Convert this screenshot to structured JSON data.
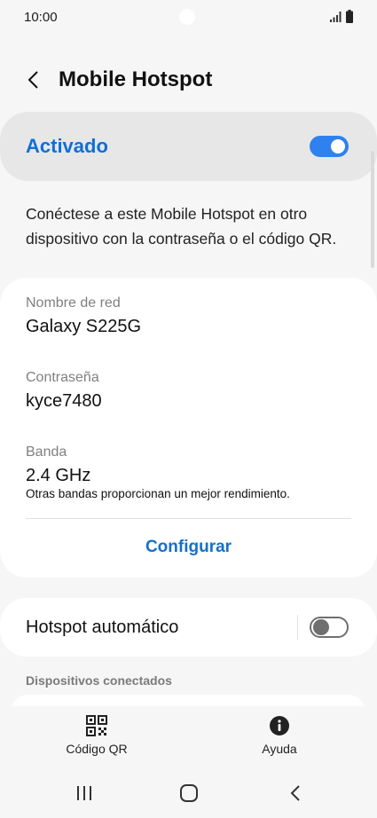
{
  "status_bar": {
    "time": "10:00"
  },
  "header": {
    "title": "Mobile Hotspot"
  },
  "master": {
    "label": "Activado",
    "enabled": true,
    "accent_color": "#0f6fd6"
  },
  "description": "Conéctese a este Mobile Hotspot en otro dispositivo con la contraseña o el código QR.",
  "network": {
    "name_label": "Nombre de red",
    "name_value": "Galaxy S225G",
    "password_label": "Contraseña",
    "password_value": "kyce7480",
    "band_label": "Banda",
    "band_value": "2.4 GHz",
    "band_note": "Otras bandas proporcionan un mejor rendimiento.",
    "configure_label": "Configurar"
  },
  "auto_hotspot": {
    "label": "Hotspot automático",
    "enabled": false
  },
  "connected_devices": {
    "header": "Dispositivos conectados"
  },
  "bottom_bar": {
    "qr_label": "Código QR",
    "qr_icon": "qr-code-icon",
    "help_label": "Ayuda",
    "help_icon": "info-icon"
  },
  "nav_bar": {
    "icons": [
      "recents-icon",
      "home-icon",
      "back-icon"
    ]
  }
}
